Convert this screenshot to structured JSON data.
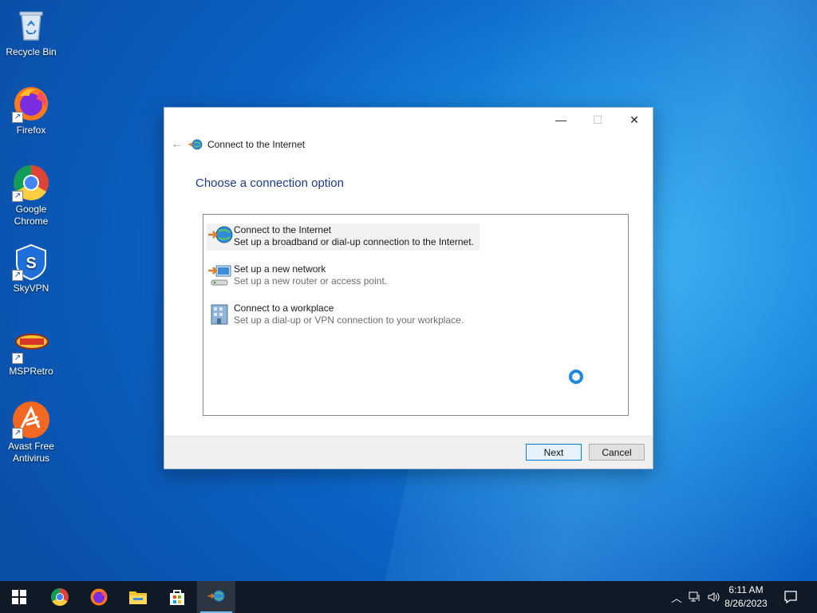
{
  "desktop": {
    "icons": [
      {
        "label": "Recycle Bin",
        "icon": "recycle-bin-icon"
      },
      {
        "label": "Firefox",
        "icon": "firefox-icon"
      },
      {
        "label": "Google Chrome",
        "icon": "chrome-icon"
      },
      {
        "label": "SkyVPN",
        "icon": "skyvpn-icon"
      },
      {
        "label": "MSPRetro",
        "icon": "mspretro-icon"
      },
      {
        "label": "Avast Free Antivirus",
        "icon": "avast-icon"
      }
    ]
  },
  "dialog": {
    "window_title": "Connect to the Internet",
    "heading": "Choose a connection option",
    "options": [
      {
        "title": "Connect to the Internet",
        "description": "Set up a broadband or dial-up connection to the Internet.",
        "icon": "globe-connect-icon",
        "selected": true
      },
      {
        "title": "Set up a new network",
        "description": "Set up a new router or access point.",
        "icon": "router-icon",
        "selected": false
      },
      {
        "title": "Connect to a workplace",
        "description": "Set up a dial-up or VPN connection to your workplace.",
        "icon": "workplace-icon",
        "selected": false
      }
    ],
    "buttons": {
      "next": "Next",
      "cancel": "Cancel"
    },
    "controls": {
      "minimize": "—",
      "maximize": "☐",
      "close": "✕"
    }
  },
  "taskbar": {
    "items": [
      "start-icon",
      "chrome-icon",
      "firefox-icon",
      "file-explorer-icon",
      "store-icon",
      "connect-internet-icon"
    ],
    "tray": {
      "time": "6:11 AM",
      "date": "8/26/2023"
    }
  },
  "colors": {
    "accent": "#0078d7",
    "heading": "#1e3a8a",
    "taskbar": "#101a26"
  }
}
